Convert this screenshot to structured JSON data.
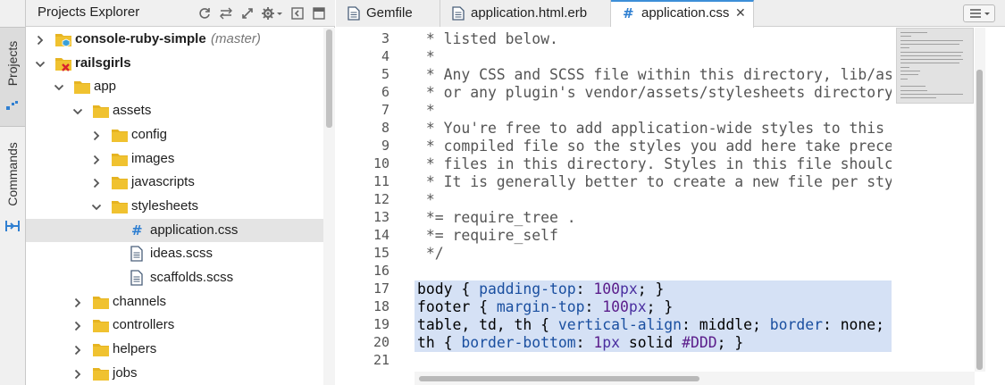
{
  "sidebar_tabs": [
    {
      "label": "Projects",
      "icon": "projects-tab-icon"
    },
    {
      "label": "Commands",
      "icon": "commands-tab-icon"
    }
  ],
  "explorer": {
    "title": "Projects Explorer",
    "tools": [
      "refresh-icon",
      "collapse-all-icon",
      "link-editor-icon",
      "settings-icon",
      "minimize-icon",
      "maximize-icon"
    ],
    "tree": [
      {
        "label": "console-ruby-simple",
        "branch": "(master)",
        "bold": true,
        "expanded": false,
        "icon": "project-folder-icon"
      },
      {
        "label": "railsgirls",
        "branch": "",
        "bold": true,
        "expanded": true,
        "icon": "project-error-folder-icon"
      },
      {
        "label": "app",
        "expanded": true,
        "icon": "folder-icon"
      },
      {
        "label": "assets",
        "expanded": true,
        "icon": "folder-icon"
      },
      {
        "label": "config",
        "expanded": false,
        "icon": "folder-icon"
      },
      {
        "label": "images",
        "expanded": false,
        "icon": "folder-icon"
      },
      {
        "label": "javascripts",
        "expanded": false,
        "icon": "folder-icon"
      },
      {
        "label": "stylesheets",
        "expanded": true,
        "icon": "folder-icon"
      },
      {
        "label": "application.css",
        "selected": true,
        "icon": "css-file-icon"
      },
      {
        "label": "ideas.scss",
        "icon": "file-icon"
      },
      {
        "label": "scaffolds.scss",
        "icon": "file-icon"
      },
      {
        "label": "channels",
        "expanded": false,
        "icon": "folder-icon"
      },
      {
        "label": "controllers",
        "expanded": false,
        "icon": "folder-icon"
      },
      {
        "label": "helpers",
        "expanded": false,
        "icon": "folder-icon"
      },
      {
        "label": "jobs",
        "expanded": false,
        "icon": "folder-icon"
      }
    ]
  },
  "editor": {
    "tabs": [
      {
        "label": "Gemfile",
        "active": false,
        "icon": "file-icon"
      },
      {
        "label": "application.html.erb",
        "active": false,
        "icon": "file-icon"
      },
      {
        "label": "application.css",
        "active": true,
        "icon": "css-hash-icon",
        "close": "✕"
      }
    ],
    "line_numbers": [
      "3",
      "4",
      "5",
      "6",
      "7",
      "8",
      "9",
      "10",
      "11",
      "12",
      "13",
      "14",
      "15",
      "16",
      "17",
      "18",
      "19",
      "20",
      "21"
    ],
    "lines": [
      " * listed below.",
      " *",
      " * Any CSS and SCSS file within this directory, lib/as",
      " * or any plugin's vendor/assets/stylesheets directory",
      " *",
      " * You're free to add application-wide styles to this",
      " * compiled file so the styles you add here take prece",
      " * files in this directory. Styles in this file shoulc",
      " * It is generally better to create a new file per sty",
      " *",
      " *= require_tree .",
      " *= require_self",
      " */",
      "",
      "body { padding-top: 100px; }",
      "footer { margin-top: 100px; }",
      "table, td, th { vertical-align: middle; border: none;",
      "th { border-bottom: 1px solid #DDD; }",
      ""
    ]
  }
}
